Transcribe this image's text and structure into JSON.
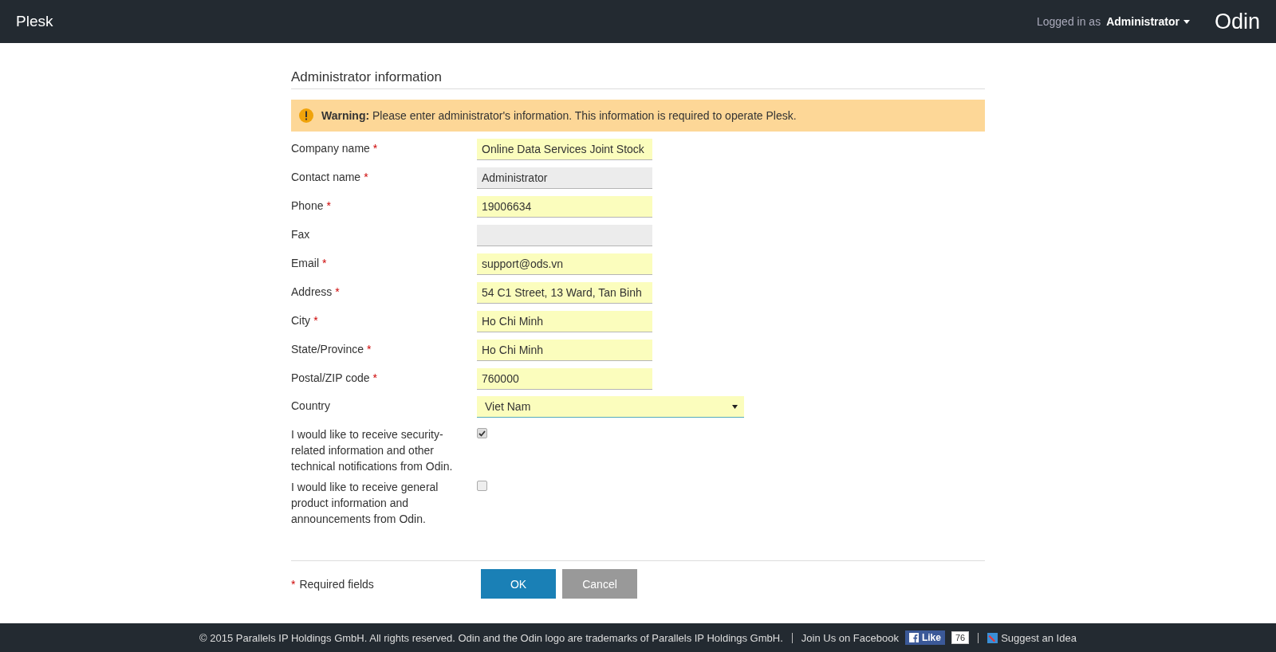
{
  "header": {
    "logo": "Plesk",
    "logged_in_label": "Logged in as",
    "user": "Administrator",
    "brand": "Odin"
  },
  "form": {
    "title": "Administrator information",
    "warning": "**Warning:** Please enter administrator's information. This information is required to operate Plesk.",
    "fields": [
      {
        "kind": "text",
        "label": "Company name",
        "required": true,
        "highlighted": true,
        "value": "Online Data Services Joint Stock"
      },
      {
        "kind": "text",
        "label": "Contact name",
        "required": true,
        "highlighted": false,
        "value": "Administrator"
      },
      {
        "kind": "text",
        "label": "Phone",
        "required": true,
        "highlighted": true,
        "value": "19006634"
      },
      {
        "kind": "text",
        "label": "Fax",
        "required": false,
        "highlighted": false
      },
      {
        "kind": "text",
        "label": "Email",
        "required": true,
        "highlighted": true,
        "value": "support@ods.vn"
      },
      {
        "kind": "text",
        "label": "Address",
        "required": true,
        "highlighted": true,
        "value": "54 C1 Street, 13 Ward, Tan Binh"
      },
      {
        "kind": "text",
        "label": "City",
        "required": true,
        "highlighted": true,
        "value": "Ho Chi Minh"
      },
      {
        "kind": "text",
        "label": "State/Province",
        "required": true,
        "highlighted": true,
        "value": "Ho Chi Minh"
      },
      {
        "kind": "text",
        "label": "Postal/ZIP code",
        "required": true,
        "highlighted": true,
        "value": "760000"
      },
      {
        "kind": "select",
        "label": "Country",
        "value": "Viet Nam"
      },
      {
        "kind": "checkbox",
        "label": "I would like to receive security-related information and other technical notifications from Odin.",
        "checked": true
      },
      {
        "kind": "checkbox",
        "label": "I would like to receive general product information and announcements from Odin.",
        "checked": false
      }
    ],
    "required_note": "Required fields",
    "required_mark": "*",
    "buttons": [
      {
        "kind": "primary",
        "label": "OK"
      },
      {
        "kind": "secondary",
        "label": "Cancel"
      }
    ]
  },
  "footer": {
    "copyright": "© 2015 Parallels IP Holdings GmbH. All rights reserved. Odin and the Odin logo are trademarks of Parallels IP Holdings GmbH.",
    "facebook": "Join Us on Facebook",
    "like": "Like",
    "like_count": "76",
    "suggest": "Suggest an Idea"
  }
}
